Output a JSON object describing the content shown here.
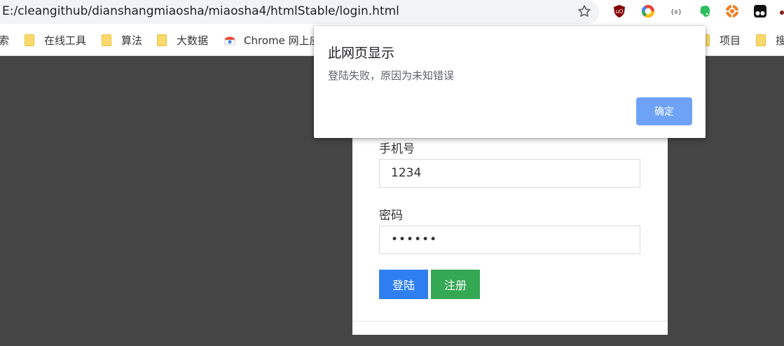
{
  "browser": {
    "url": "E:/cleangithub/dianshangmiaosha/miaosha4/htmlStable/login.html",
    "icons": [
      "star-icon",
      "ublock-icon",
      "chrome-color-icon",
      "json-icon",
      "evernote-icon",
      "orange-extension-icon",
      "tampermonkey-icon"
    ]
  },
  "bookmarks": {
    "items": [
      {
        "label": "索",
        "icon": "none"
      },
      {
        "label": "在线工具",
        "icon": "folder-icon"
      },
      {
        "label": "算法",
        "icon": "folder-icon"
      },
      {
        "label": "大数据",
        "icon": "folder-icon"
      },
      {
        "label": "Chrome 网上应",
        "icon": "chrome-store-icon"
      },
      {
        "label": "项目",
        "icon": "folder-icon"
      },
      {
        "label": "搜",
        "icon": "folder-icon"
      }
    ]
  },
  "form": {
    "phone_label": "手机号",
    "phone_value": "1234",
    "password_label": "密码",
    "password_value": "••••••",
    "login_button": "登陆",
    "register_button": "注册"
  },
  "dialog": {
    "title": "此网页显示",
    "message": "登陆失败，原因为未知错误",
    "ok_button": "确定"
  },
  "colors": {
    "login_button": "#2f7ff0",
    "register_button": "#34a853",
    "dialog_ok": "#6ea2f7",
    "page_background": "#454545"
  }
}
